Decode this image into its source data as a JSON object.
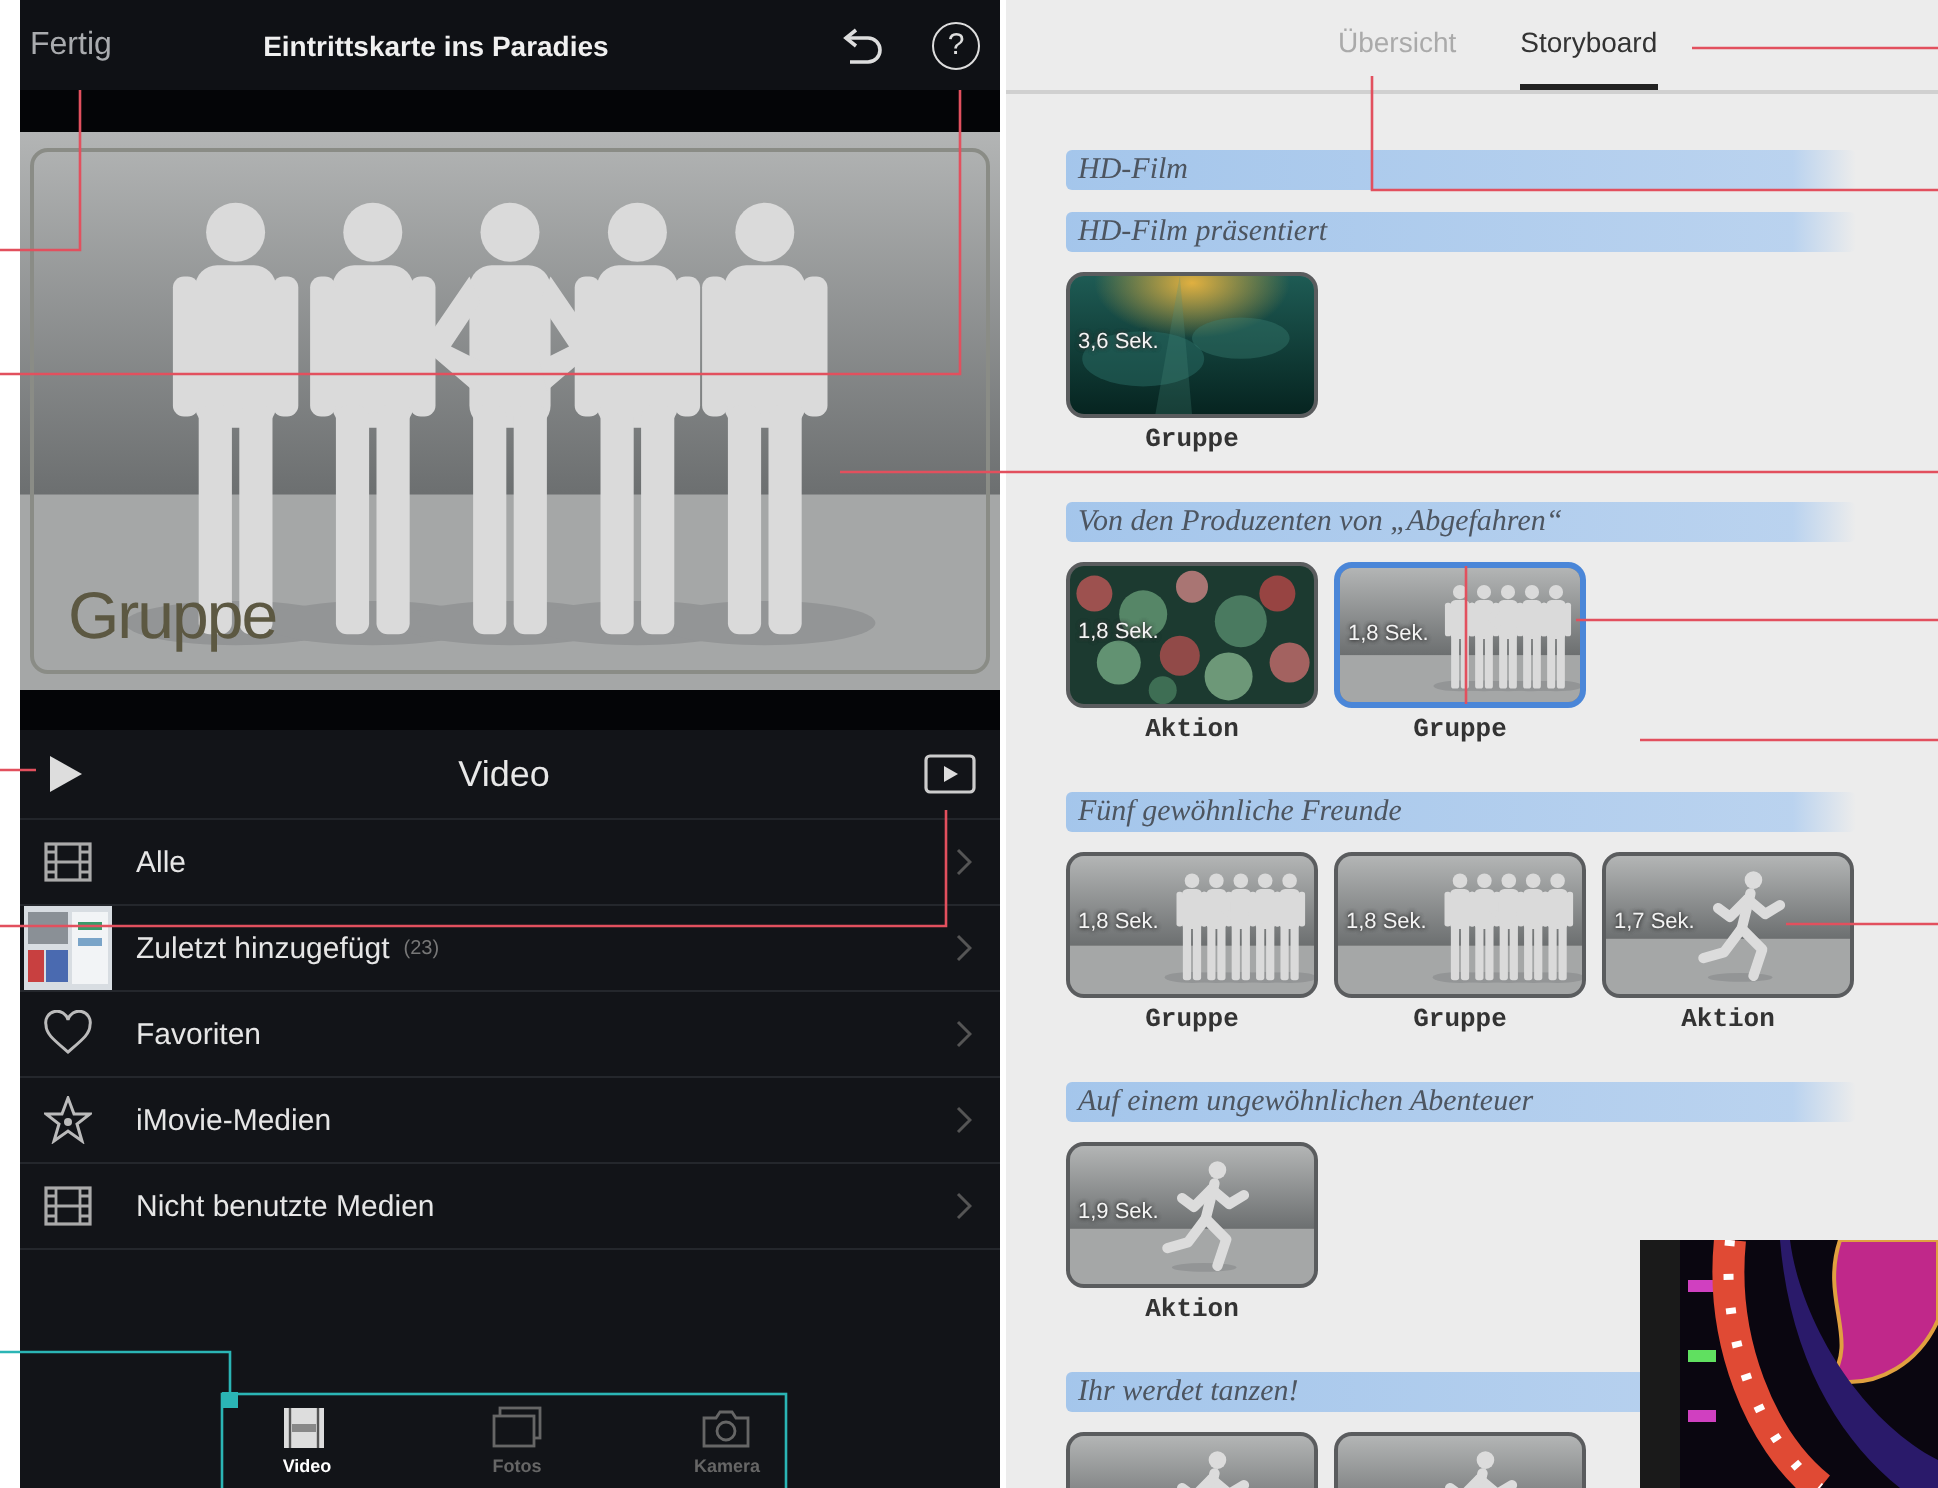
{
  "editor": {
    "done_button": "Fertig",
    "title": "Eintrittskarte ins Paradies",
    "help_button": "?"
  },
  "preview": {
    "label": "Gruppe"
  },
  "media": {
    "title": "Video",
    "items": [
      {
        "kind": "film",
        "label": "Alle"
      },
      {
        "kind": "thumbnail",
        "label": "Zuletzt hinzugefügt",
        "count": "(23)"
      },
      {
        "kind": "heart",
        "label": "Favoriten"
      },
      {
        "kind": "star",
        "label": "iMovie-Medien"
      },
      {
        "kind": "film",
        "label": "Nicht benutzte Medien"
      }
    ]
  },
  "bottom_tabs": [
    {
      "kind": "video",
      "label": "Video",
      "selected": true
    },
    {
      "kind": "photos",
      "label": "Fotos",
      "selected": false
    },
    {
      "kind": "camera",
      "label": "Kamera",
      "selected": false
    }
  ],
  "view_tabs": [
    {
      "label": "Übersicht",
      "selected": false
    },
    {
      "label": "Storyboard",
      "selected": true
    }
  ],
  "storyboard": [
    {
      "heading": "HD-Film"
    },
    {
      "heading": "HD-Film präsentiert",
      "clips": [
        {
          "kind": "picture",
          "duration": "3,6 Sek.",
          "label": "Gruppe",
          "selected": false
        }
      ]
    },
    {
      "heading": "Von den Produzenten von „Abgefahren“",
      "clips": [
        {
          "kind": "picture",
          "duration": "1,8 Sek.",
          "label": "Aktion",
          "selected": false
        },
        {
          "kind": "group",
          "duration": "1,8 Sek.",
          "label": "Gruppe",
          "selected": true
        }
      ]
    },
    {
      "heading": "Fünf gewöhnliche Freunde",
      "clips": [
        {
          "kind": "group",
          "duration": "1,8 Sek.",
          "label": "Gruppe",
          "selected": false
        },
        {
          "kind": "group",
          "duration": "1,8 Sek.",
          "label": "Gruppe",
          "selected": false
        },
        {
          "kind": "runner",
          "duration": "1,7 Sek.",
          "label": "Aktion",
          "selected": false
        }
      ]
    },
    {
      "heading": "Auf einem ungewöhnlichen Abenteuer",
      "clips": [
        {
          "kind": "runner",
          "duration": "1,9 Sek.",
          "label": "Aktion",
          "selected": false
        }
      ]
    },
    {
      "heading": "Ihr werdet tanzen!",
      "clips": [
        {
          "kind": "runner",
          "selected": false
        },
        {
          "kind": "runner",
          "selected": false
        }
      ]
    }
  ]
}
